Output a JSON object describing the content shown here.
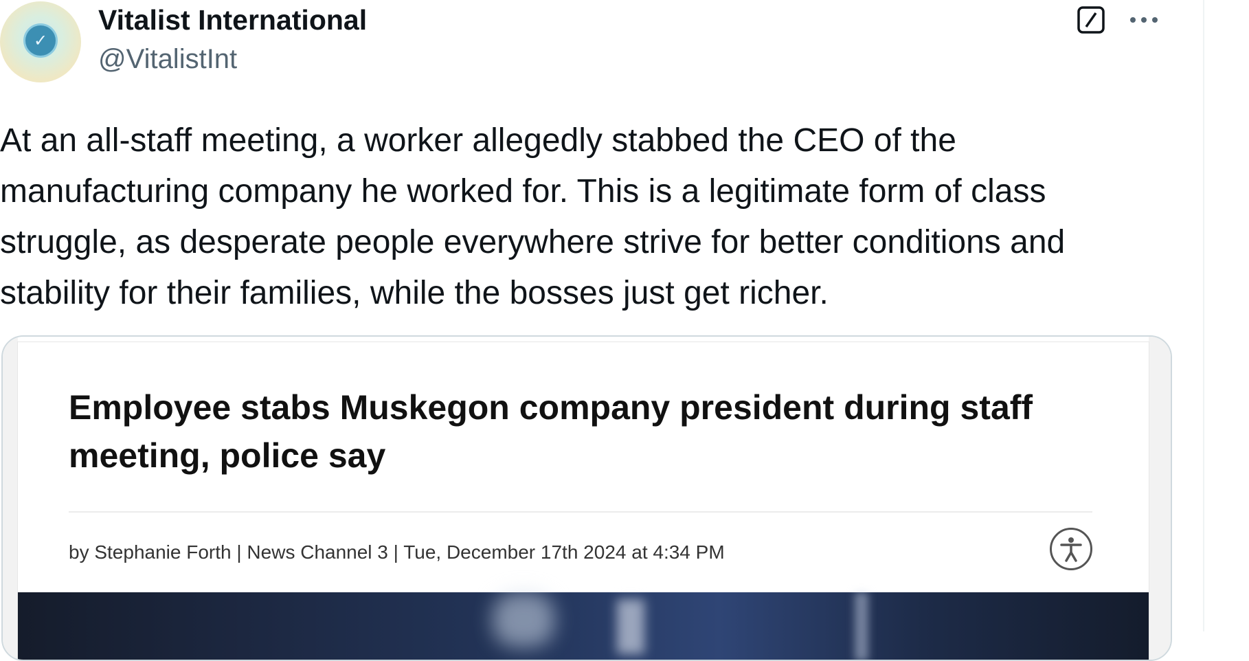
{
  "author": {
    "display_name": "Vitalist International",
    "handle": "@VitalistInt",
    "avatar_icon": "vitalist-logo-icon"
  },
  "actions": {
    "grok_icon": "grok-icon",
    "more_icon": "more-options-icon"
  },
  "tweet": {
    "text": "At an all-staff meeting, a worker allegedly stabbed the CEO of the manufacturing company he worked for. This is a legitimate form of class struggle, as desperate people everywhere strive for better conditions and stability for their families, while the bosses just get richer."
  },
  "card": {
    "headline": "Employee stabs Muskegon company president during staff meeting, police say",
    "byline": "by Stephanie Forth | News Channel 3 | Tue, December 17th 2024 at 4:34 PM",
    "accessibility_icon": "accessibility-icon"
  },
  "colors": {
    "text_primary": "#0f1419",
    "text_secondary": "#536471",
    "card_border": "#cfd9de"
  }
}
